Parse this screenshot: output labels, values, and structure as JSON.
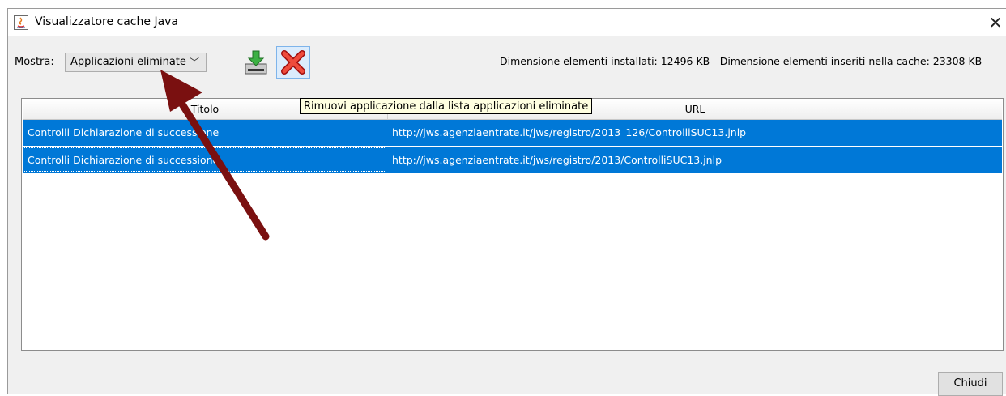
{
  "window": {
    "title": "Visualizzatore cache Java",
    "close_glyph": "✕"
  },
  "toolbar": {
    "show_label": "Mostra:",
    "show_selected": "Applicazioni eliminate",
    "install_icon": "install-icon",
    "remove_icon": "remove-icon",
    "info": "Dimensione elementi installati:  12496 KB - Dimensione elementi inseriti nella cache:  23308 KB"
  },
  "tooltip": {
    "text": "Rimuovi applicazione dalla lista applicazioni eliminate"
  },
  "table": {
    "columns": [
      "Titolo",
      "URL"
    ],
    "rows": [
      {
        "title": "Controlli Dichiarazione di successione",
        "url": "http://jws.agenziaentrate.it/jws/registro/2013_126/ControlliSUC13.jnlp"
      },
      {
        "title": "Controlli Dichiarazione di successione",
        "url": "http://jws.agenziaentrate.it/jws/registro/2013/ControlliSUC13.jnlp"
      }
    ],
    "selected_color": "#0078d7"
  },
  "footer": {
    "close_label": "Chiudi"
  },
  "annotation": {
    "arrow_color": "#7a1010"
  }
}
